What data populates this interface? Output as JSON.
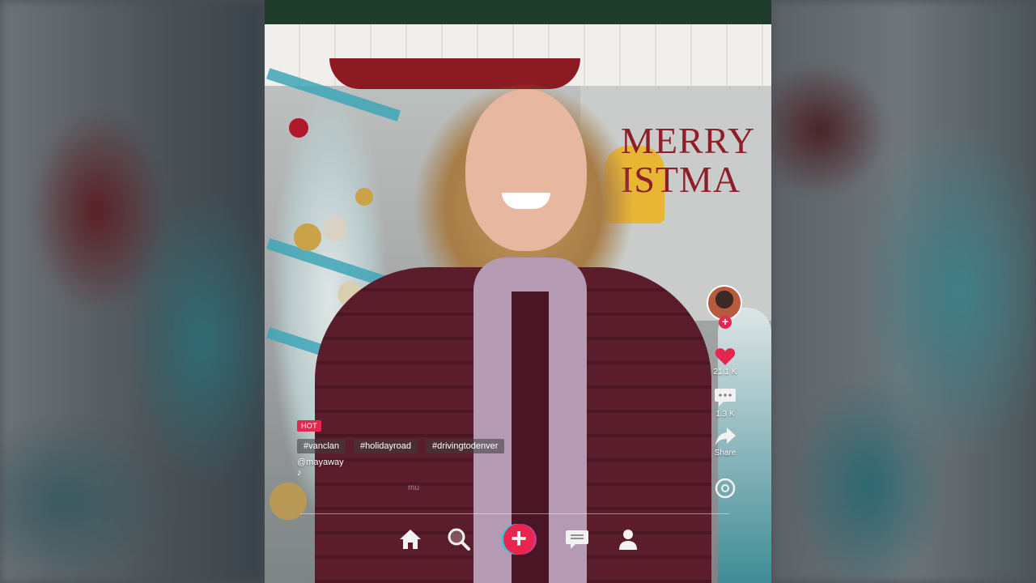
{
  "video": {
    "sign_text_line1": "MERRY",
    "sign_text_line2": "ISTMA"
  },
  "caption": {
    "badge": "HOT",
    "hashtags": [
      "#vanclan",
      "#holidayroad",
      "#drivingtodenver"
    ],
    "username": "@mayaway",
    "music_icon": "♪",
    "music_title": "mu"
  },
  "actions": {
    "avatar_icon": "profile-avatar",
    "follow_label": "+",
    "likes": "21.1 K",
    "comments": "1.3 K",
    "share": "Share",
    "like_color": "#e8254f"
  },
  "nav": {
    "items": [
      "home-icon",
      "search-icon",
      "create-icon",
      "messages-icon",
      "profile-icon"
    ],
    "create_label": "+"
  },
  "colors": {
    "accent": "#e8254f",
    "accent_cyan": "#39c6d9"
  }
}
